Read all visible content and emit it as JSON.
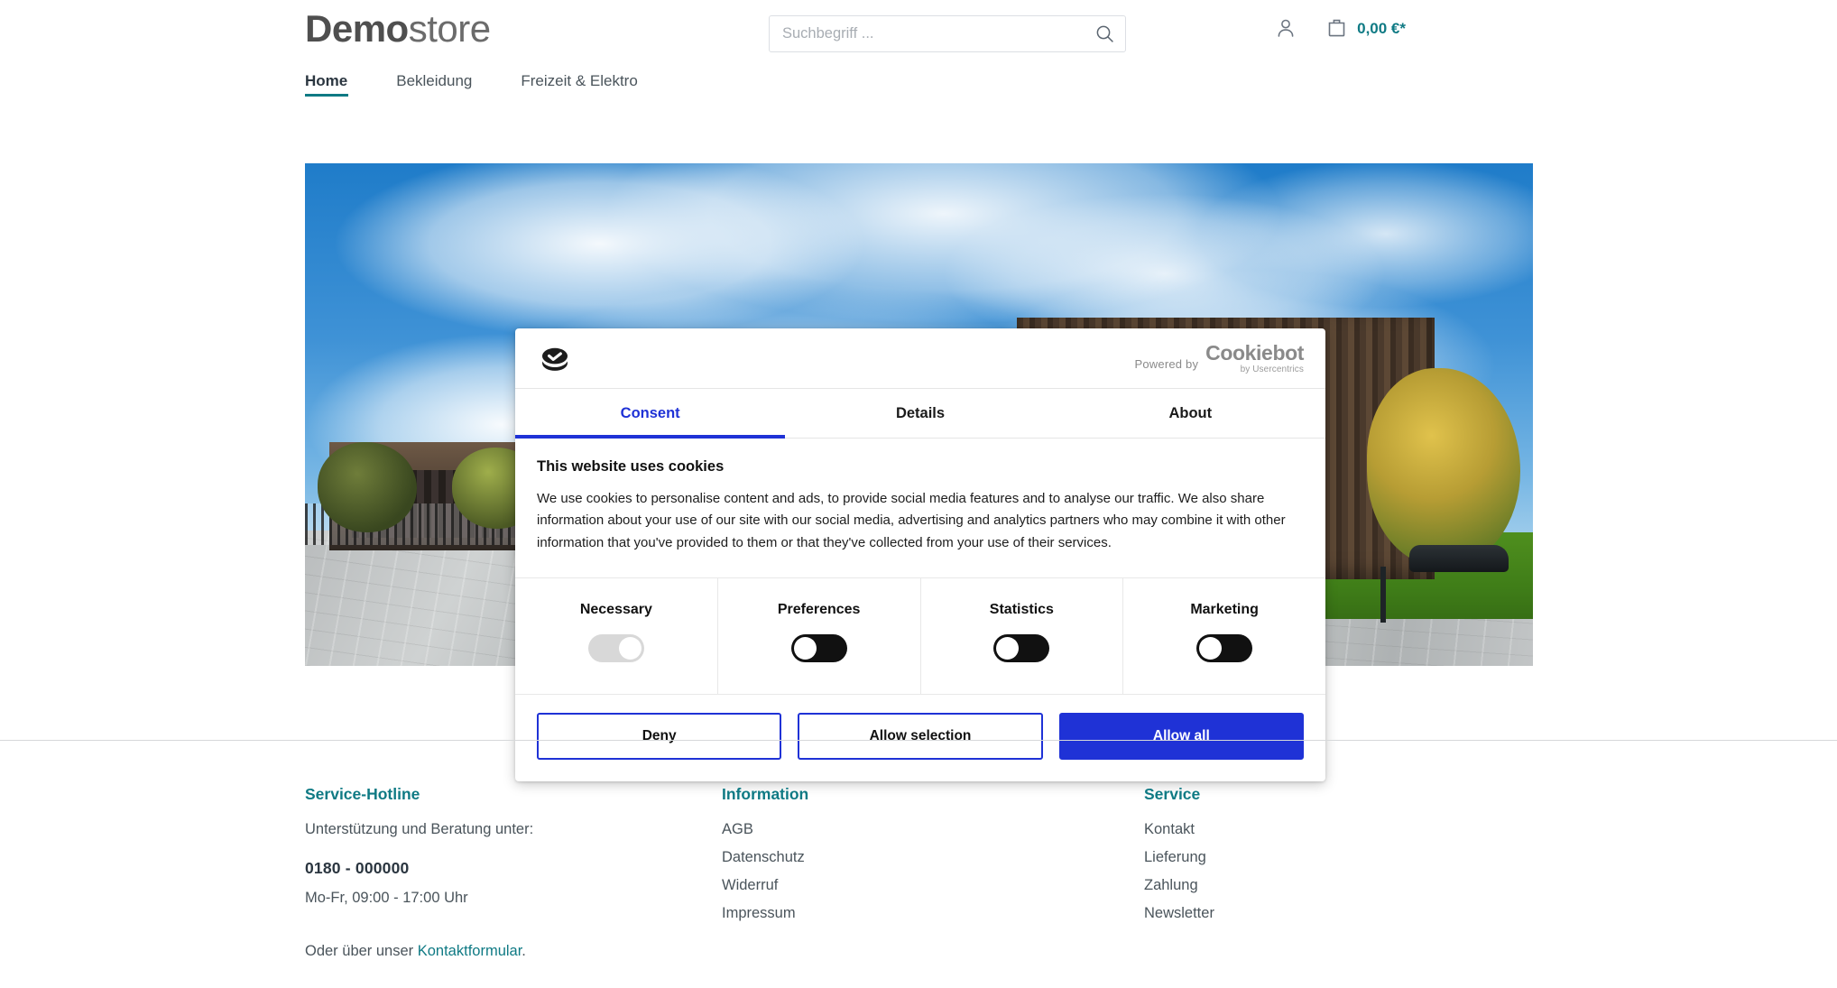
{
  "brand": {
    "bold": "Demo",
    "light": "store"
  },
  "search": {
    "placeholder": "Suchbegriff ...",
    "value": "",
    "icon": "search-icon"
  },
  "header_actions": {
    "account_icon": "person-icon",
    "cart_icon": "shopping-bag-icon",
    "cart_amount": "0,00 €*"
  },
  "nav": {
    "items": [
      {
        "label": "Home",
        "active": true
      },
      {
        "label": "Bekleidung",
        "active": false
      },
      {
        "label": "Freizeit & Elektro",
        "active": false
      }
    ]
  },
  "cookie_dialog": {
    "logo_icon": "cookie-check-icon",
    "powered_by": "Powered by",
    "provider_name": "Cookiebot",
    "provider_sub": "by Usercentrics",
    "tabs": [
      {
        "label": "Consent",
        "active": true
      },
      {
        "label": "Details",
        "active": false
      },
      {
        "label": "About",
        "active": false
      }
    ],
    "title": "This website uses cookies",
    "text": "We use cookies to personalise content and ads, to provide social media features and to analyse our traffic. We also share information about your use of our site with our social media, advertising and analytics partners who may combine it with other information that you've provided to them or that they've collected from your use of their services.",
    "categories": [
      {
        "label": "Necessary",
        "state": "on-locked"
      },
      {
        "label": "Preferences",
        "state": "off"
      },
      {
        "label": "Statistics",
        "state": "off"
      },
      {
        "label": "Marketing",
        "state": "off"
      }
    ],
    "buttons": {
      "deny": "Deny",
      "allow_selection": "Allow selection",
      "allow_all": "Allow all"
    },
    "accent_color": "#1f32d6"
  },
  "footer": {
    "col1": {
      "heading": "Service-Hotline",
      "subtitle": "Unterstützung und Beratung unter:",
      "phone": "0180 - 000000",
      "hours": "Mo-Fr, 09:00 - 17:00 Uhr",
      "contact_prefix": "Oder über unser ",
      "contact_link": "Kontaktformular",
      "contact_suffix": "."
    },
    "col2": {
      "heading": "Information",
      "items": [
        "AGB",
        "Datenschutz",
        "Widerruf",
        "Impressum"
      ]
    },
    "col3": {
      "heading": "Service",
      "items": [
        "Kontakt",
        "Lieferung",
        "Zahlung",
        "Newsletter"
      ]
    }
  },
  "theme": {
    "accent_teal": "#0f7a84",
    "text_dark": "#2b3640",
    "text_body": "#4a545b"
  }
}
